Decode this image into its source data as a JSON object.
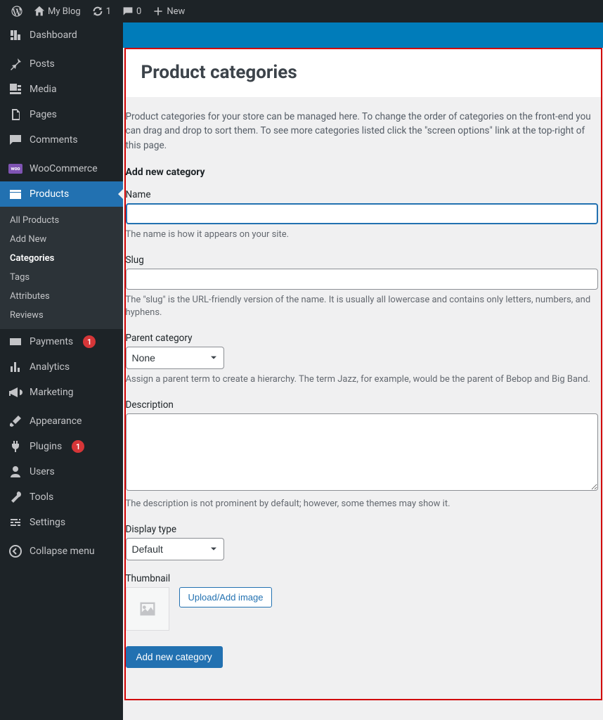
{
  "adminbar": {
    "site_name": "My Blog",
    "updates_count": "1",
    "comments_count": "0",
    "new_label": "New"
  },
  "sidebar": {
    "dashboard": "Dashboard",
    "posts": "Posts",
    "media": "Media",
    "pages": "Pages",
    "comments": "Comments",
    "woocommerce": "WooCommerce",
    "products": "Products",
    "products_sub": {
      "all": "All Products",
      "add_new": "Add New",
      "categories": "Categories",
      "tags": "Tags",
      "attributes": "Attributes",
      "reviews": "Reviews"
    },
    "payments": "Payments",
    "payments_badge": "1",
    "analytics": "Analytics",
    "marketing": "Marketing",
    "appearance": "Appearance",
    "plugins": "Plugins",
    "plugins_badge": "1",
    "users": "Users",
    "tools": "Tools",
    "settings": "Settings",
    "collapse": "Collapse menu"
  },
  "page": {
    "title": "Product categories",
    "intro": "Product categories for your store can be managed here. To change the order of categories on the front-end you can drag and drop to sort them. To see more categories listed click the \"screen options\" link at the top-right of this page.",
    "add_heading": "Add new category",
    "fields": {
      "name": {
        "label": "Name",
        "value": "",
        "hint": "The name is how it appears on your site."
      },
      "slug": {
        "label": "Slug",
        "value": "",
        "hint": "The \"slug\" is the URL-friendly version of the name. It is usually all lowercase and contains only letters, numbers, and hyphens."
      },
      "parent": {
        "label": "Parent category",
        "selected": "None",
        "hint": "Assign a parent term to create a hierarchy. The term Jazz, for example, would be the parent of Bebop and Big Band."
      },
      "description": {
        "label": "Description",
        "value": "",
        "hint": "The description is not prominent by default; however, some themes may show it."
      },
      "display_type": {
        "label": "Display type",
        "selected": "Default"
      },
      "thumbnail": {
        "label": "Thumbnail",
        "upload_button": "Upload/Add image"
      }
    },
    "submit_label": "Add new category"
  },
  "colors": {
    "accent": "#2271b1",
    "banner": "#007cba",
    "border_highlight": "#d10000",
    "badge": "#d63638"
  }
}
